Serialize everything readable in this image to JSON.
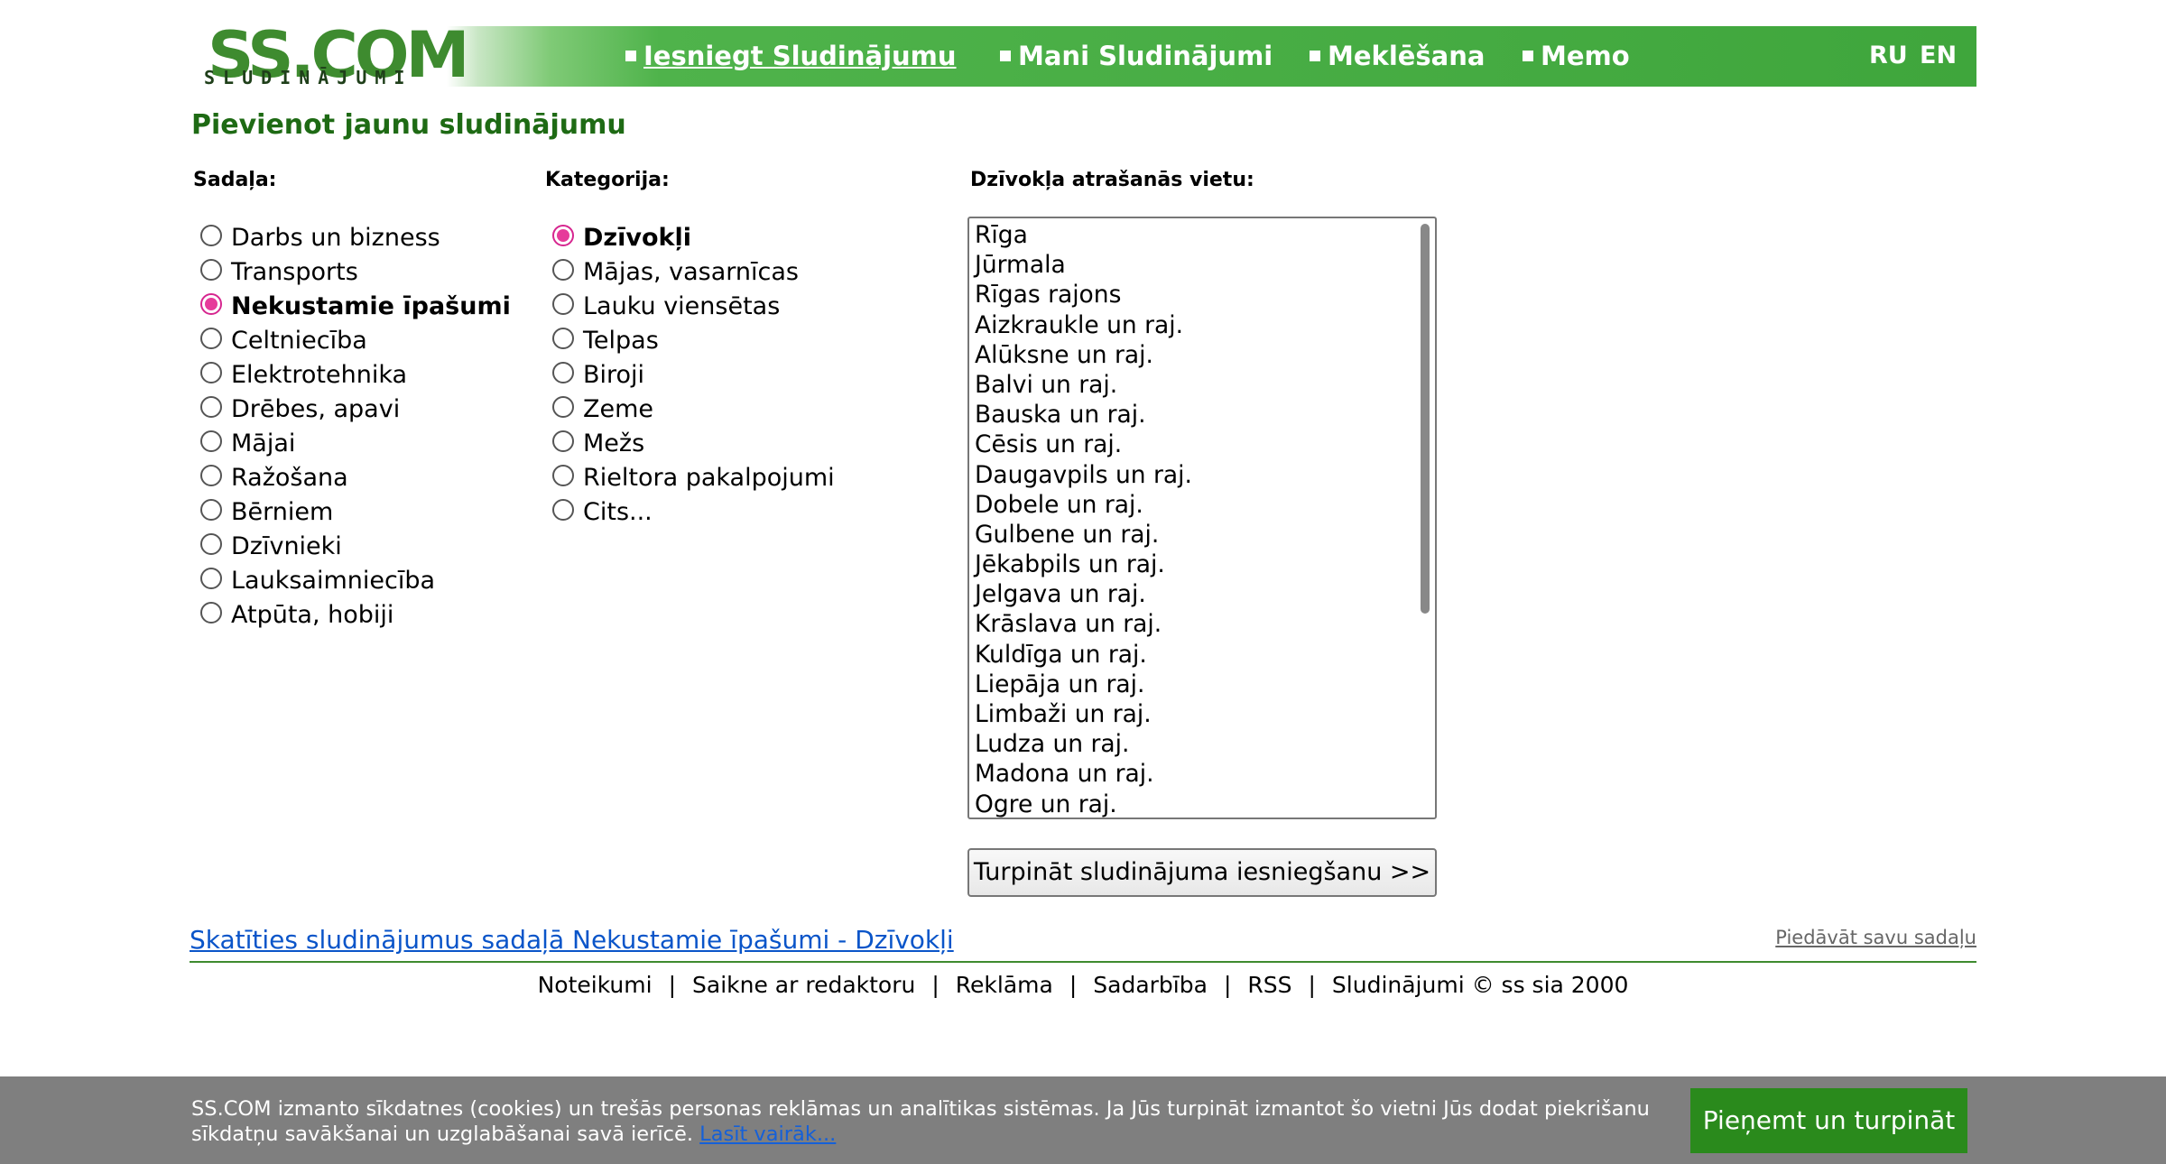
{
  "logo": {
    "main": "SS.COM",
    "sub": "SLUDINĀJUMI"
  },
  "nav": {
    "items": [
      {
        "label": "Iesniegt Sludinājumu",
        "active": true
      },
      {
        "label": "Mani Sludinājumi",
        "active": false
      },
      {
        "label": "Meklēšana",
        "active": false
      },
      {
        "label": "Memo",
        "active": false
      }
    ],
    "languages": [
      "RU",
      "EN"
    ]
  },
  "page_title": "Pievienot jaunu sludinājumu",
  "sections": {
    "heading": "Sadaļa:",
    "items": [
      {
        "label": "Darbs un bizness",
        "selected": false
      },
      {
        "label": "Transports",
        "selected": false
      },
      {
        "label": "Nekustamie īpašumi",
        "selected": true
      },
      {
        "label": "Celtniecība",
        "selected": false
      },
      {
        "label": "Elektrotehnika",
        "selected": false
      },
      {
        "label": "Drēbes, apavi",
        "selected": false
      },
      {
        "label": "Mājai",
        "selected": false
      },
      {
        "label": "Ražošana",
        "selected": false
      },
      {
        "label": "Bērniem",
        "selected": false
      },
      {
        "label": "Dzīvnieki",
        "selected": false
      },
      {
        "label": "Lauksaimniecība",
        "selected": false
      },
      {
        "label": "Atpūta, hobiji",
        "selected": false
      }
    ]
  },
  "categories": {
    "heading": "Kategorija:",
    "items": [
      {
        "label": "Dzīvokļi",
        "selected": true
      },
      {
        "label": "Mājas, vasarnīcas",
        "selected": false
      },
      {
        "label": "Lauku viensētas",
        "selected": false
      },
      {
        "label": "Telpas",
        "selected": false
      },
      {
        "label": "Biroji",
        "selected": false
      },
      {
        "label": "Zeme",
        "selected": false
      },
      {
        "label": "Mežs",
        "selected": false
      },
      {
        "label": "Rieltora pakalpojumi",
        "selected": false
      },
      {
        "label": "Cits...",
        "selected": false
      }
    ]
  },
  "location": {
    "heading": "Dzīvokļa atrašanās vietu:",
    "options": [
      "Rīga",
      "Jūrmala",
      "Rīgas rajons",
      "Aizkraukle un raj.",
      "Alūksne un raj.",
      "Balvi un raj.",
      "Bauska un raj.",
      "Cēsis un raj.",
      "Daugavpils un raj.",
      "Dobele un raj.",
      "Gulbene un raj.",
      "Jēkabpils un raj.",
      "Jelgava un raj.",
      "Krāslava un raj.",
      "Kuldīga un raj.",
      "Liepāja un raj.",
      "Limbaži un raj.",
      "Ludza un raj.",
      "Madona un raj.",
      "Ogre un raj."
    ]
  },
  "continue_button": "Turpināt sludinājuma iesniegšanu >>",
  "view_link": "Skatīties sludinājumus sadaļā Nekustamie īpašumi - Dzīvokļi",
  "suggest_link": "Piedāvāt savu sadaļu",
  "footer": {
    "links": [
      "Noteikumi",
      "Saikne ar redaktoru",
      "Reklāma",
      "Sadarbība",
      "RSS",
      "Sludinājumi © ss sia 2000"
    ],
    "separator": "|"
  },
  "cookie": {
    "text": "SS.COM izmanto sīkdatnes (cookies) un trešās personas reklāmas un analītikas sistēmas. Ja Jūs turpināt izmantot šo vietni Jūs dodat piekrišanu sīkdatņu savākšanai un uzglabāšanai savā ierīcē.",
    "more": "Lasīt vairāk...",
    "accept": "Pieņemt un turpināt"
  },
  "colors": {
    "brand_green": "#3fa63c",
    "title_green": "#1e6a14",
    "link_blue": "#0a55c9",
    "radio_selected": "#e63b9a",
    "cookie_bg": "#7f7f7f",
    "cookie_button": "#2a8a1c"
  }
}
